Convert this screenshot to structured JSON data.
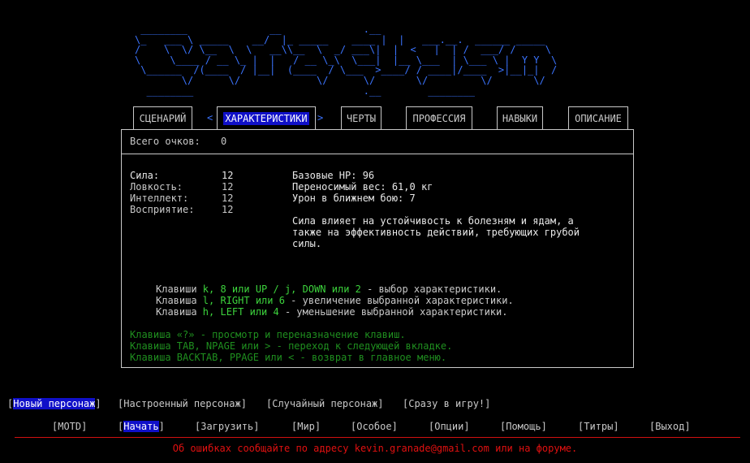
{
  "logo_ascii": " ________              __              .__\n\\_   ___ \\ _____    __/  |_ _____    ____ |  |   ___.__.  ______ _____\n/    \\  \\/ \\__  \\  \\   __\\\\__  \\  _/ ___\\|  |  <   |  | /  ___/ /     \\\n\\     \\____ / __ \\_ |  |   / __ \\_\\  \\___|  |__ \\___  | \\___ \\ |  Y Y  \\\n \\______  /(____  / |__|  (____  / \\___  >____/ / ____|/____  >|__|_|  /\n        \\/      \\/             \\/      \\/       \\/         \\/       \\/\n  ________                             .__        ________",
  "tabs": [
    {
      "label": "СЦЕНАРИЙ"
    },
    {
      "label": "ХАРАКТЕРИСТИКИ"
    },
    {
      "label": "ЧЕРТЫ"
    },
    {
      "label": "ПРОФЕССИЯ"
    },
    {
      "label": "НАВЫКИ"
    },
    {
      "label": "ОПИСАНИЕ"
    }
  ],
  "active_brackets": {
    "left": "<",
    "right": ">"
  },
  "points": {
    "label": "Всего очков:",
    "value": "0"
  },
  "stats": [
    {
      "label": "Сила:",
      "value": "12"
    },
    {
      "label": "Ловкость:",
      "value": "12"
    },
    {
      "label": "Интеллект:",
      "value": "12"
    },
    {
      "label": "Восприятие:",
      "value": "12"
    }
  ],
  "derived": {
    "hp": "Базовые HP: 96",
    "carry": "Переносимый вес: 61,0 кг",
    "melee": "Урон в ближнем бою: 7"
  },
  "description": "Сила влияет на устойчивость к болезням и ядам, а\nтакже на эффективность действий, требующих грубой\nсилы.",
  "key_help": [
    {
      "pre": "Клавиши ",
      "keys": "k, 8 или UP / j, DOWN или 2",
      "post": " - выбор характеристики."
    },
    {
      "pre": "Клавиша ",
      "keys": "l, RIGHT или 6",
      "post": " - увеличение выбранной характеристики."
    },
    {
      "pre": "Клавиша ",
      "keys": "h, LEFT или 4",
      "post": " - уменьшение выбранной характеристики."
    }
  ],
  "nav_help": [
    "Клавиша «?» - просмотр и переназначение клавиш.",
    "Клавиша TAB, NPAGE или > - переход к следующей вкладке.",
    "Клавиша BACKTAB, PPAGE или < - возврат в главное меню."
  ],
  "new_char_menu": [
    {
      "label": "Новый персонаж"
    },
    {
      "label": "Настроенный персонаж"
    },
    {
      "label": "Случайный персонаж"
    },
    {
      "label": "Сразу в игру!"
    }
  ],
  "main_menu": [
    {
      "label": "MOTD"
    },
    {
      "label": "Начать"
    },
    {
      "label": "Загрузить"
    },
    {
      "label": "Мир"
    },
    {
      "label": "Особое"
    },
    {
      "label": "Опции"
    },
    {
      "label": "Помощь"
    },
    {
      "label": "Титры"
    },
    {
      "label": "Выход"
    }
  ],
  "footer": "Об ошибках сообщайте по адресу kevin.granade@gmail.com или на форуме.",
  "colors": {
    "logo": "#3b74ff",
    "selection": "#1010c8",
    "help_keys": "#3cd23c",
    "nav_help": "#1f8f1f",
    "footer": "#e01010"
  }
}
